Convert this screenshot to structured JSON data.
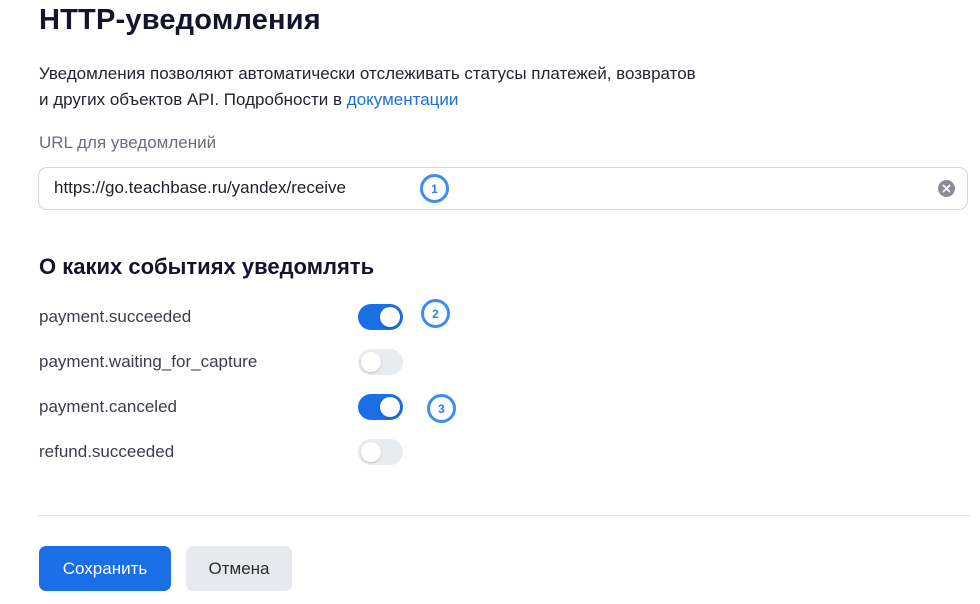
{
  "header": {
    "title": "HTTP-уведомления",
    "description_line1": "Уведомления позволяют автоматически отслеживать статусы платежей, возвратов",
    "description_line2": "и других объектов API. Подробности в ",
    "docs_link": "документации"
  },
  "url_field": {
    "label": "URL для уведомлений",
    "value": "https://go.teachbase.ru/yandex/receive",
    "clear_icon": "clear-icon"
  },
  "events": {
    "title": "О каких событиях уведомлять",
    "items": [
      {
        "name": "payment.succeeded",
        "enabled": true
      },
      {
        "name": "payment.waiting_for_capture",
        "enabled": false
      },
      {
        "name": "payment.canceled",
        "enabled": true
      },
      {
        "name": "refund.succeeded",
        "enabled": false
      }
    ]
  },
  "annotations": [
    "1",
    "2",
    "3"
  ],
  "actions": {
    "save_label": "Сохранить",
    "cancel_label": "Отмена"
  },
  "colors": {
    "accent": "#1a6fe6",
    "toggle_off": "#e8ebf0",
    "annotation": "#3d8ef0",
    "link": "#1a6fd9"
  }
}
